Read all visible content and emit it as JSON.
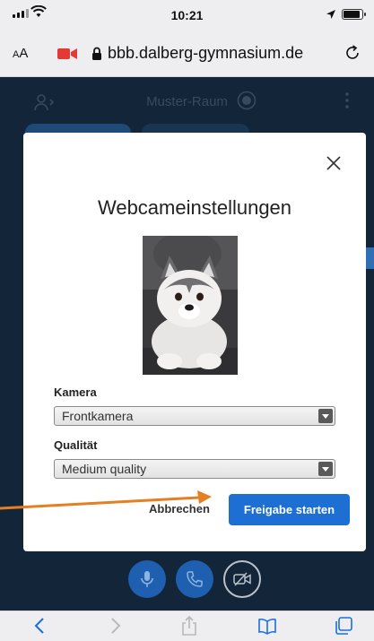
{
  "status_bar": {
    "time": "10:21",
    "battery_level": 0.9
  },
  "browser": {
    "text_size_label": "AA",
    "url": "bbb.dalberg-gymnasium.de",
    "recording_color": "#e53935"
  },
  "room": {
    "name": "Muster-Raum"
  },
  "modal": {
    "title": "Webcameinstellungen",
    "camera_label": "Kamera",
    "camera_value": "Frontkamera",
    "quality_label": "Qualität",
    "quality_value": "Medium quality",
    "cancel_label": "Abbrechen",
    "start_label": "Freigabe starten",
    "primary_color": "#1d6fd4"
  },
  "controls": {
    "mic": "microphone-icon",
    "hangup": "phone-icon",
    "camera": "camera-off-icon"
  },
  "toolbar": {
    "back": "chevron-left-icon",
    "forward": "chevron-right-icon",
    "share": "share-icon",
    "bookmarks": "book-icon",
    "tabs": "tabs-icon"
  },
  "annotation_color": "#e67e22"
}
